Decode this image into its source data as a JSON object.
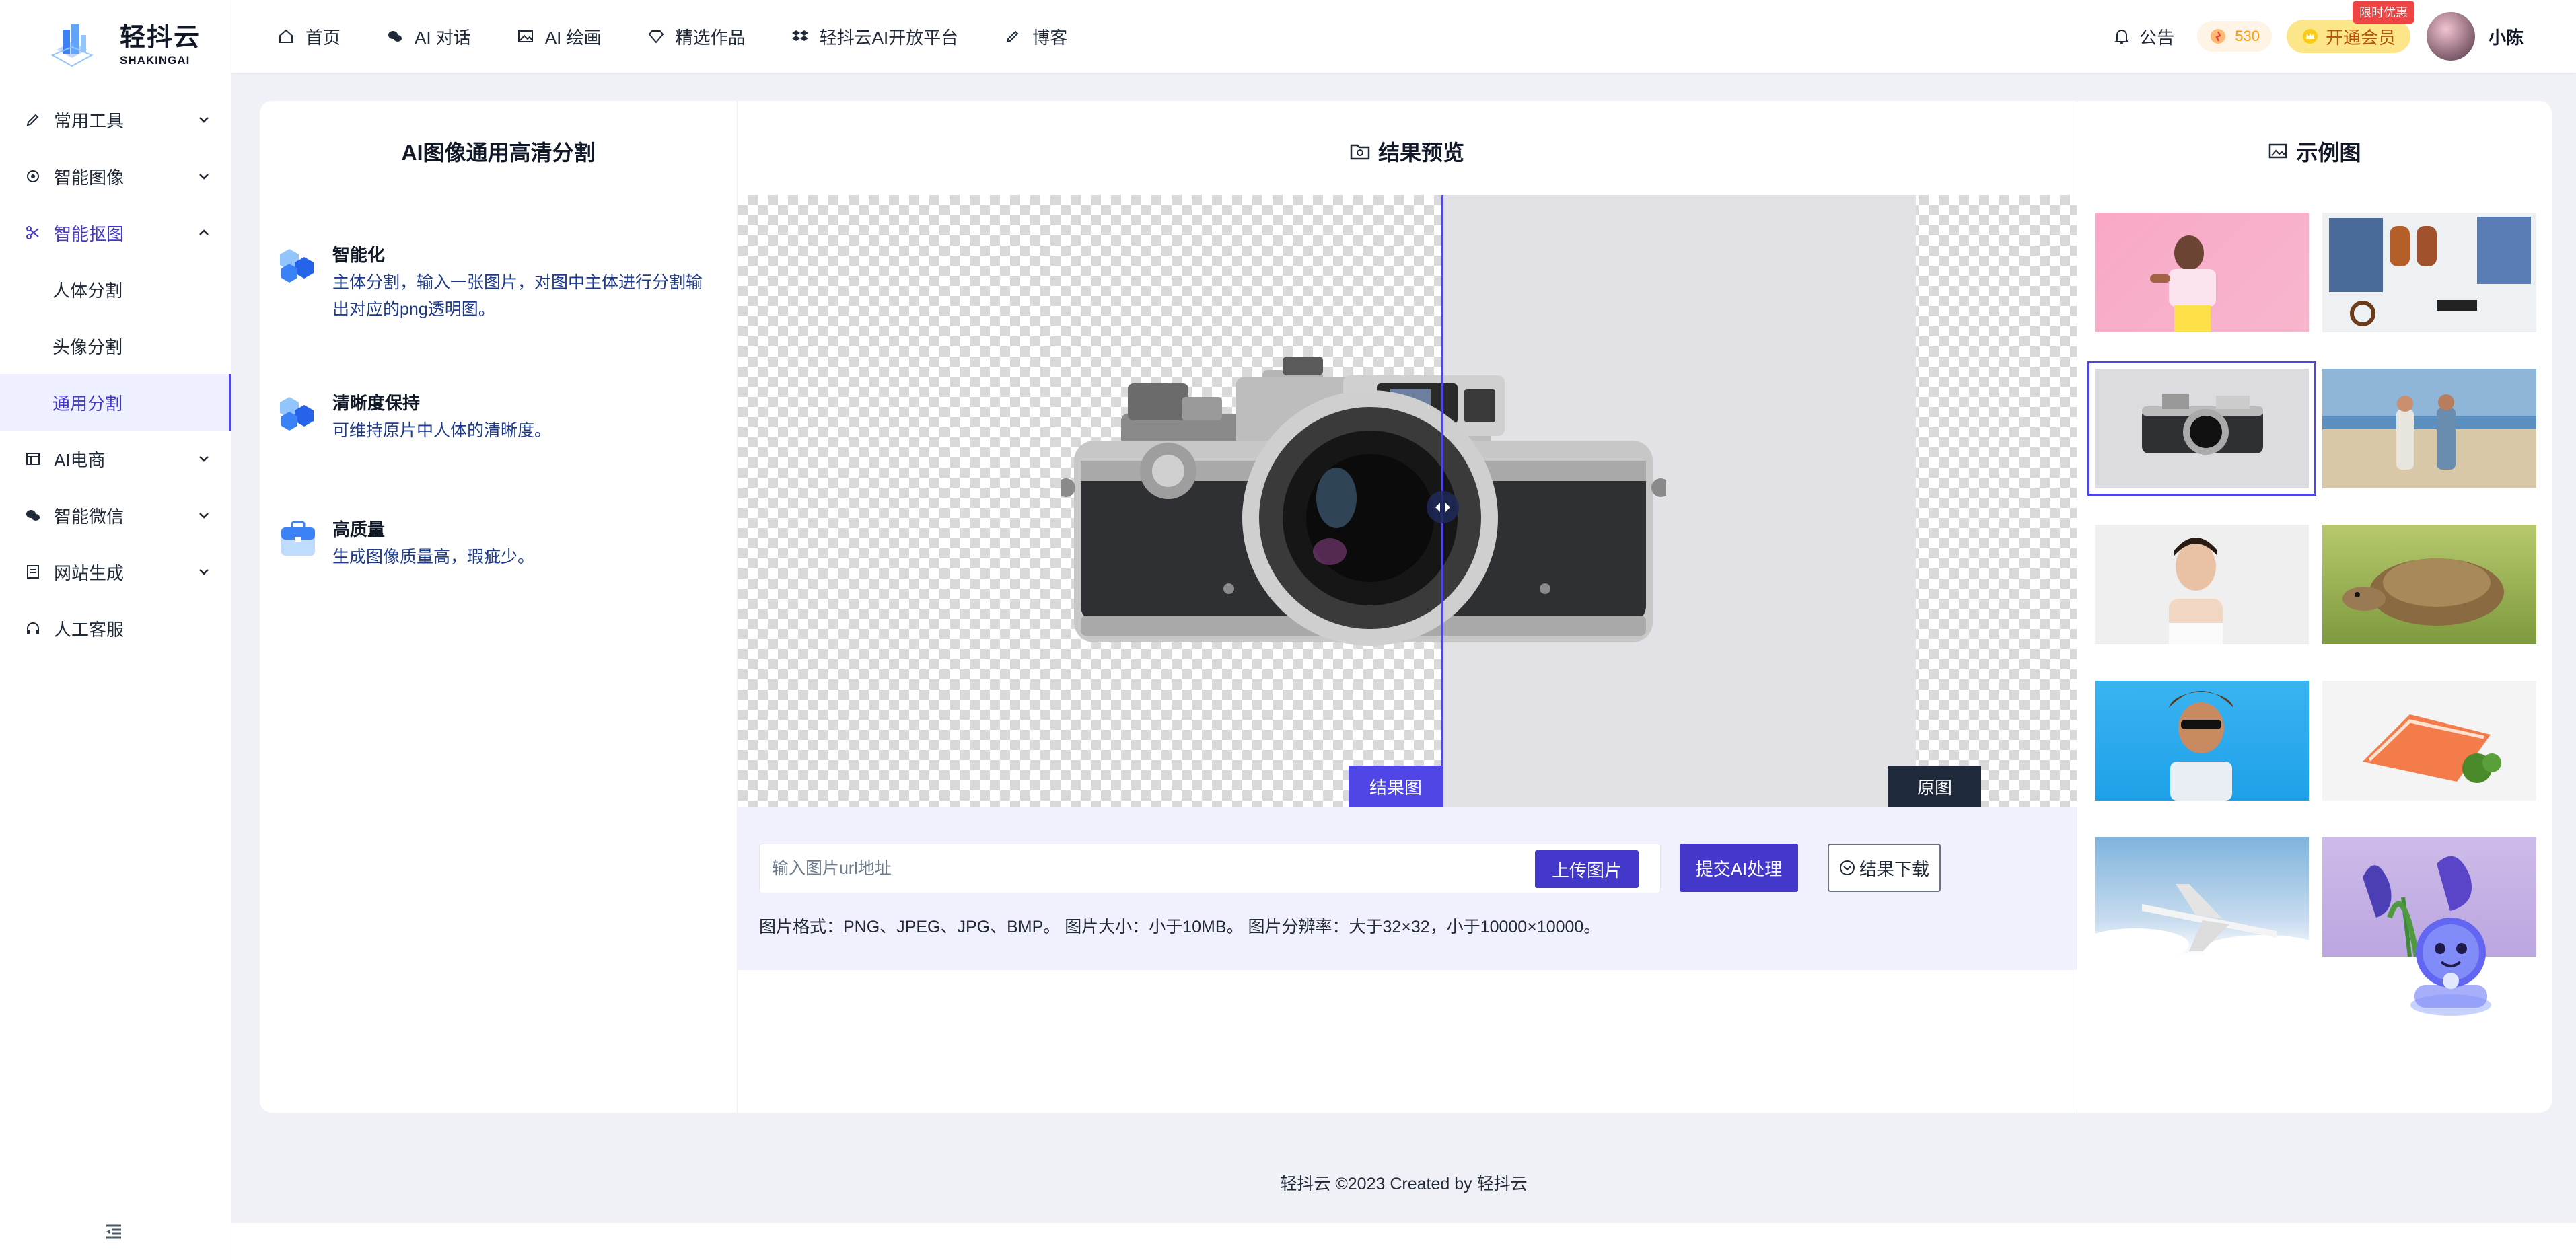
{
  "app": {
    "logo_title": "轻抖云",
    "logo_sub": "SHAKINGAI"
  },
  "sidebar": {
    "items": [
      {
        "label": "常用工具",
        "icon": "pen-icon"
      },
      {
        "label": "智能图像",
        "icon": "target-icon"
      },
      {
        "label": "智能抠图",
        "icon": "scissors-icon"
      },
      {
        "label": "AI电商",
        "icon": "store-icon"
      },
      {
        "label": "智能微信",
        "icon": "wechat-icon"
      },
      {
        "label": "网站生成",
        "icon": "document-icon"
      },
      {
        "label": "人工客服",
        "icon": "headset-icon"
      }
    ],
    "submenu": [
      {
        "label": "人体分割"
      },
      {
        "label": "头像分割"
      },
      {
        "label": "通用分割"
      }
    ]
  },
  "nav": {
    "items": [
      {
        "label": "首页",
        "icon": "home-icon"
      },
      {
        "label": "AI 对话",
        "icon": "chat-icon"
      },
      {
        "label": "AI 绘画",
        "icon": "image-icon"
      },
      {
        "label": "精选作品",
        "icon": "diamond-icon"
      },
      {
        "label": "轻抖云AI开放平台",
        "icon": "dropbox-icon"
      },
      {
        "label": "博客",
        "icon": "pen-icon"
      }
    ],
    "notice": "公告",
    "points": "530",
    "vip_label": "开通会员",
    "vip_badge": "限时优惠",
    "username": "小陈"
  },
  "left_panel": {
    "title": "AI图像通用高清分割",
    "features": [
      {
        "title": "智能化",
        "desc": "主体分割，输入一张图片，对图中主体进行分割输出对应的png透明图。"
      },
      {
        "title": "清晰度保持",
        "desc": "可维持原片中人体的清晰度。"
      },
      {
        "title": "高质量",
        "desc": "生成图像质量高，瑕疵少。"
      }
    ]
  },
  "middle_panel": {
    "title": "结果预览",
    "tag_result": "结果图",
    "tag_original": "原图",
    "url_placeholder": "输入图片url地址",
    "upload_button": "上传图片",
    "submit_button": "提交AI处理",
    "download_button": "结果下载",
    "hint": "图片格式：PNG、JPEG、JPG、BMP。 图片大小：小于10MB。 图片分辨率：大于32×32，小于10000×10000。"
  },
  "right_panel": {
    "title": "示例图",
    "samples": [
      {
        "subject": "woman-pink"
      },
      {
        "subject": "clothes-flatlay"
      },
      {
        "subject": "camera",
        "selected": true
      },
      {
        "subject": "couple-beach"
      },
      {
        "subject": "woman-portrait"
      },
      {
        "subject": "tortoise"
      },
      {
        "subject": "woman-sunglasses"
      },
      {
        "subject": "salmon"
      },
      {
        "subject": "airplane"
      },
      {
        "subject": "iris-flowers"
      }
    ]
  },
  "footer": {
    "text": "轻抖云 ©2023 Created by 轻抖云"
  },
  "colors": {
    "accent": "#4338ca",
    "sidebar_active_bg": "#eef0ff",
    "vip_bg": "#fde68a",
    "badge_red": "#ef4444"
  }
}
